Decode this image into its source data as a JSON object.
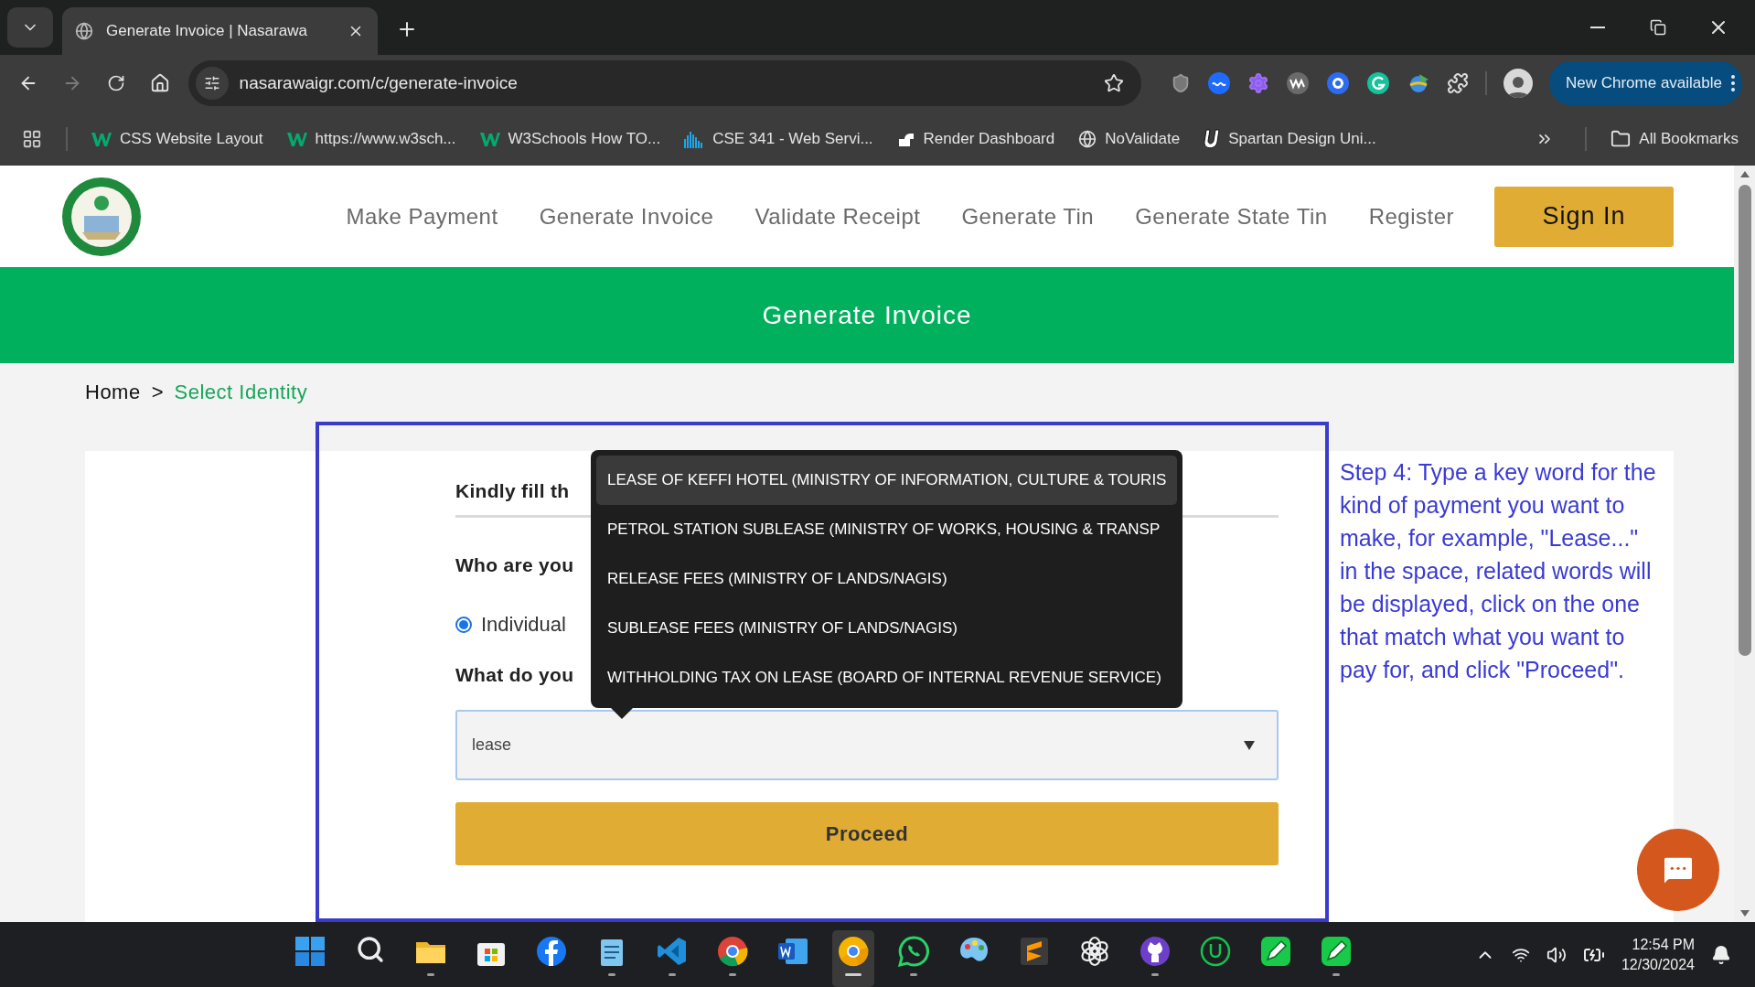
{
  "browser": {
    "tab": {
      "title": "Generate Invoice | Nasarawa"
    },
    "url": "nasarawaigr.com/c/generate-invoice",
    "forward_disabled": true,
    "update_button": "New Chrome available",
    "bookmarks": [
      {
        "label": "CSS Website Layout",
        "kind": "w3"
      },
      {
        "label": "https://www.w3sch...",
        "kind": "w3"
      },
      {
        "label": "W3Schools How TO...",
        "kind": "w3"
      },
      {
        "label": "CSE 341 - Web Servi...",
        "kind": "bars"
      },
      {
        "label": "Render Dashboard",
        "kind": "render"
      },
      {
        "label": "NoValidate",
        "kind": "globe"
      },
      {
        "label": "Spartan Design Uni...",
        "kind": "u"
      }
    ],
    "all_bookmarks": "All Bookmarks"
  },
  "site": {
    "nav": [
      "Make Payment",
      "Generate Invoice",
      "Validate Receipt",
      "Generate Tin",
      "Generate State Tin",
      "Register"
    ],
    "sign_in": "Sign In",
    "banner": "Generate Invoice",
    "breadcrumb": [
      {
        "label": "Home",
        "current": false
      },
      {
        "label": "Select Identity",
        "current": true
      }
    ],
    "breadcrumb_separator": ">"
  },
  "form": {
    "heading": "Kindly fill th",
    "question_1": "Who are you",
    "radio": {
      "label": "Individual",
      "selected": true
    },
    "question_2": "What do you",
    "input": {
      "value": "lease"
    },
    "suggestions": [
      {
        "label": "LEASE OF KEFFI HOTEL (MINISTRY OF INFORMATION, CULTURE & TOURIS",
        "selected": true
      },
      {
        "label": "PETROL STATION SUBLEASE (MINISTRY OF WORKS, HOUSING & TRANSP",
        "selected": false
      },
      {
        "label": "RELEASE FEES (MINISTRY OF LANDS/NAGIS)",
        "selected": false
      },
      {
        "label": "SUBLEASE FEES (MINISTRY OF LANDS/NAGIS)",
        "selected": false
      },
      {
        "label": "WITHHOLDING TAX ON LEASE (BOARD OF INTERNAL REVENUE SERVICE)",
        "selected": false
      }
    ],
    "button": "Proceed"
  },
  "help_text": "Step 4: Type a key word for the kind of payment you want to make, for example, \"Lease...\" in the space, related words will be displayed, click on the one that match what you want to pay for, and click \"Proceed\".",
  "taskbar": {
    "apps": [
      {
        "kind": "windows",
        "running": false,
        "active": false
      },
      {
        "kind": "search",
        "running": false,
        "active": false
      },
      {
        "kind": "folder",
        "running": true,
        "active": false
      },
      {
        "kind": "store",
        "running": false,
        "active": false
      },
      {
        "kind": "facebook",
        "running": false,
        "active": false
      },
      {
        "kind": "notepad",
        "running": true,
        "active": false
      },
      {
        "kind": "vscode",
        "running": true,
        "active": false
      },
      {
        "kind": "chrome-dev",
        "running": true,
        "active": false
      },
      {
        "kind": "word",
        "running": false,
        "active": false
      },
      {
        "kind": "chrome-canary",
        "running": true,
        "active": true
      },
      {
        "kind": "whatsapp",
        "running": true,
        "active": false
      },
      {
        "kind": "paint",
        "running": false,
        "active": false
      },
      {
        "kind": "sublime",
        "running": false,
        "active": false
      },
      {
        "kind": "chatgpt",
        "running": false,
        "active": false
      },
      {
        "kind": "github",
        "running": true,
        "active": false
      },
      {
        "kind": "upwork",
        "running": false,
        "active": false
      },
      {
        "kind": "pencil",
        "running": false,
        "active": false
      },
      {
        "kind": "pencil",
        "running": true,
        "active": false
      }
    ],
    "time": "12:54 PM",
    "date": "12/30/2024"
  }
}
